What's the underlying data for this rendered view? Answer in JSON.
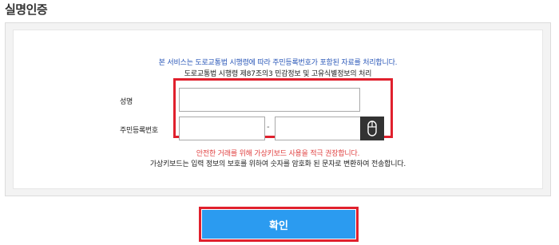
{
  "page": {
    "title": "실명인증"
  },
  "form": {
    "notice_blue": "본 서비스는 도로교통법 시행령에 따라 주민등록번호가 포함된 자료를 처리합니다.",
    "notice_black": "도로교통법 시행령 제87조의3 민감정보 및 고유식별정보의 처리",
    "name_label": "성명",
    "name_value": "",
    "rrn_label": "주민등록번호",
    "rrn_front_value": "",
    "rrn_back_value": "",
    "rrn_separator": "-",
    "keypad_icon": "mouse-icon",
    "warning_red": "안전한 거래를 위해 가상키보드 사용을 적극 권장합니다.",
    "info_black": "가상키보드는 입력 정보의 보호를 위하여 숫자를 암호화 된 문자로 변환하여 전송합니다."
  },
  "actions": {
    "confirm_label": "확인"
  },
  "colors": {
    "highlight_border": "#e0202d",
    "confirm_bg": "#2b9bf0",
    "notice_blue": "#2a57b8",
    "warning_red": "#e04040"
  }
}
